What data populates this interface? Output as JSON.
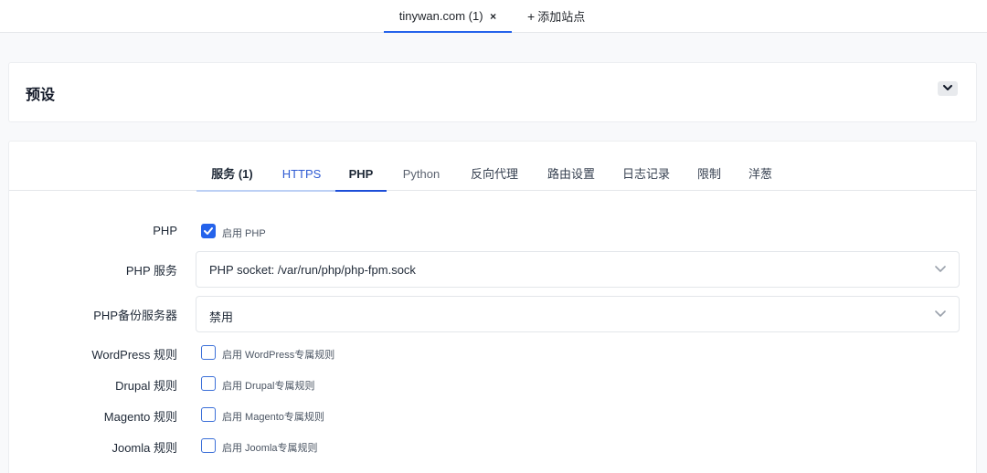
{
  "site_tabs": {
    "active_label": "tinywan.com (1)",
    "close_glyph": "×",
    "add_label": "添加站点"
  },
  "preset": {
    "title": "预设"
  },
  "tabs": [
    "服务 (1)",
    "HTTPS",
    "PHP",
    "Python",
    "反向代理",
    "路由设置",
    "日志记录",
    "限制",
    "洋葱"
  ],
  "active_tab": "PHP",
  "form": {
    "php": {
      "label": "PHP",
      "checkbox_label": "启用 PHP",
      "checked": true
    },
    "php_service": {
      "label": "PHP 服务",
      "value": "PHP socket: /var/run/php/php-fpm.sock"
    },
    "php_backup": {
      "label": "PHP备份服务器",
      "value": "禁用"
    },
    "wordpress": {
      "label": "WordPress 规则",
      "checkbox_label": "启用 WordPress专属规则",
      "checked": false
    },
    "drupal": {
      "label": "Drupal 规则",
      "checkbox_label": "启用 Drupal专属规则",
      "checked": false
    },
    "magento": {
      "label": "Magento 规则",
      "checkbox_label": "启用 Magento专属规则",
      "checked": false
    },
    "joomla": {
      "label": "Joomla 规则",
      "checkbox_label": "启用 Joomla专属规则",
      "checked": false
    }
  },
  "colors": {
    "accent": "#2563eb",
    "tab_active_underline": "#1d4ed8",
    "page_background": "#f8f9fb"
  },
  "icons": {
    "preset_toggle": "chevron-down-icon",
    "select_arrow": "chevron-down-icon",
    "checkbox_check": "check-icon"
  }
}
